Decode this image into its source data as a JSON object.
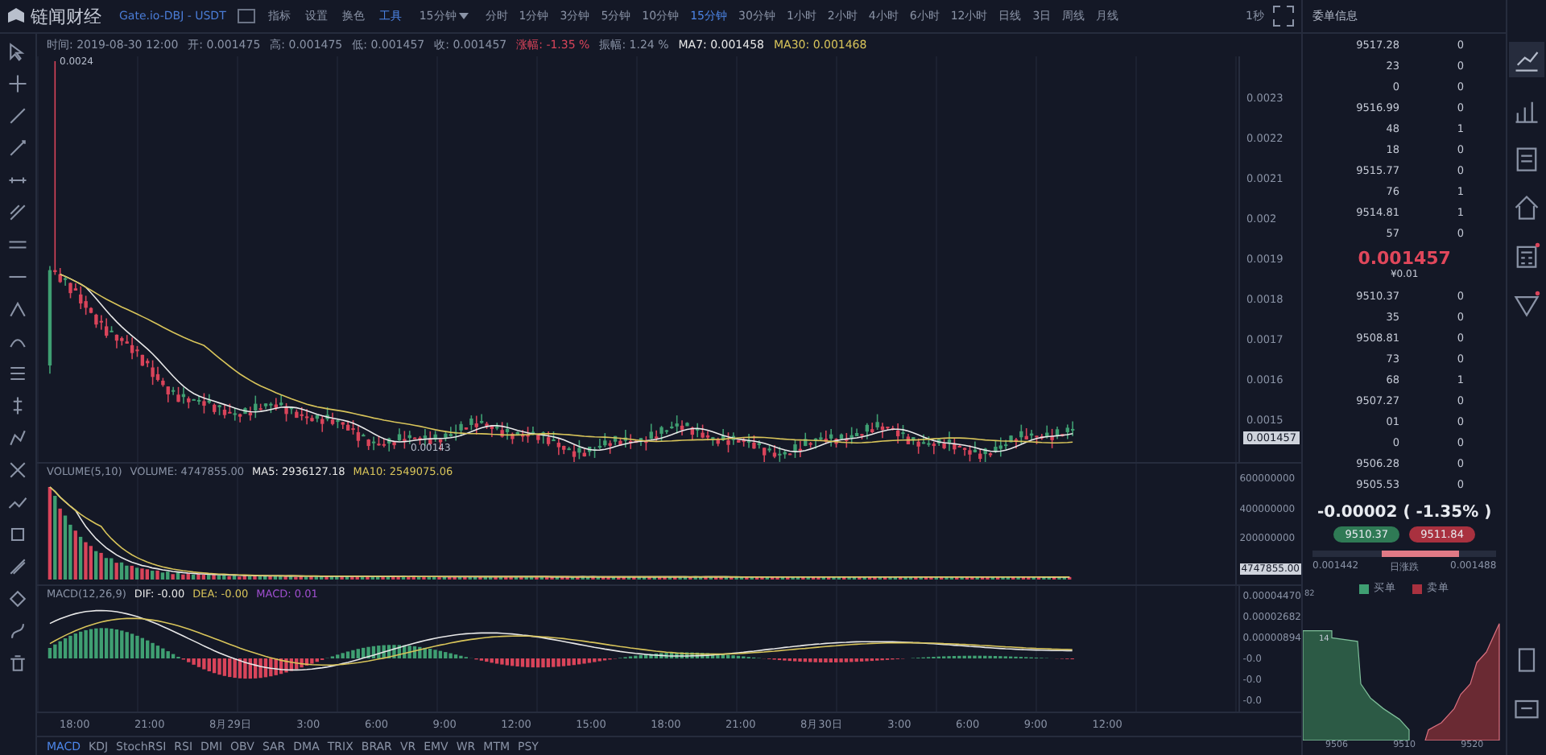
{
  "header": {
    "logo": "链闻财经",
    "pair": "Gate.io-DBJ - USDT",
    "tools": [
      {
        "label": "指标",
        "selected": false
      },
      {
        "label": "设置",
        "selected": false
      },
      {
        "label": "换色",
        "selected": false
      },
      {
        "label": "工具",
        "selected": true
      }
    ],
    "period_dropdown": "15分钟",
    "periods": [
      {
        "label": "分时",
        "selected": false
      },
      {
        "label": "1分钟",
        "selected": false
      },
      {
        "label": "3分钟",
        "selected": false
      },
      {
        "label": "5分钟",
        "selected": false
      },
      {
        "label": "10分钟",
        "selected": false
      },
      {
        "label": "15分钟",
        "selected": true
      },
      {
        "label": "30分钟",
        "selected": false
      },
      {
        "label": "1小时",
        "selected": false
      },
      {
        "label": "2小时",
        "selected": false
      },
      {
        "label": "4小时",
        "selected": false
      },
      {
        "label": "6小时",
        "selected": false
      },
      {
        "label": "12小时",
        "selected": false
      },
      {
        "label": "日线",
        "selected": false
      },
      {
        "label": "3日",
        "selected": false
      },
      {
        "label": "周线",
        "selected": false
      },
      {
        "label": "月线",
        "selected": false
      }
    ],
    "refresh": "1秒"
  },
  "info_line": [
    {
      "label": "时间:",
      "value": "2019-08-30 12:00",
      "kind": "normal"
    },
    {
      "label": "开:",
      "value": "0.001475",
      "kind": "normal"
    },
    {
      "label": "高:",
      "value": "0.001475",
      "kind": "normal"
    },
    {
      "label": "低:",
      "value": "0.001457",
      "kind": "normal"
    },
    {
      "label": "收:",
      "value": "0.001457",
      "kind": "normal"
    },
    {
      "label": "涨幅:",
      "value": "-1.35 %",
      "kind": "down"
    },
    {
      "label": "振幅:",
      "value": "1.24 %",
      "kind": "normal"
    },
    {
      "label": "MA7:",
      "value": "0.001458",
      "kind": "ma7"
    },
    {
      "label": "MA30:",
      "value": "0.001468",
      "kind": "ma30"
    }
  ],
  "price_chart": {
    "high_marker": "0.0024",
    "low_marker": "0.00143",
    "axis": [
      "0.0023",
      "0.0022",
      "0.0021",
      "0.002",
      "0.0019",
      "0.0018",
      "0.0017",
      "0.0016",
      "0.0015"
    ],
    "last_price": "0.001457"
  },
  "volume": {
    "legend": [
      {
        "label": "VOLUME(5,10)",
        "kind": "normal"
      },
      {
        "label": "VOLUME:",
        "value": "4747855.00",
        "kind": "normal"
      },
      {
        "label": "MA5:",
        "value": "2936127.18",
        "kind": "ma7"
      },
      {
        "label": "MA10:",
        "value": "2549075.06",
        "kind": "ma30"
      }
    ],
    "axis": [
      "600000000",
      "400000000",
      "200000000"
    ],
    "last": "4747855.00"
  },
  "macd": {
    "legend": [
      {
        "label": "MACD(12,26,9)",
        "kind": "normal"
      },
      {
        "label": "DIF:",
        "value": "-0.00",
        "kind": "ma7"
      },
      {
        "label": "DEA:",
        "value": "-0.00",
        "kind": "ma30"
      },
      {
        "label": "MACD:",
        "value": "0.01",
        "kind": "macd"
      }
    ],
    "axis": [
      "0.00004470",
      "0.00002682",
      "0.00000894",
      "-0.0",
      "-0.0",
      "-0.0"
    ]
  },
  "x_axis": [
    "18:00",
    "21:00",
    "8月29日",
    "3:00",
    "6:00",
    "9:00",
    "12:00",
    "15:00",
    "18:00",
    "21:00",
    "8月30日",
    "3:00",
    "6:00",
    "9:00",
    "12:00"
  ],
  "indicators": [
    {
      "label": "MACD",
      "selected": true
    },
    {
      "label": "KDJ",
      "selected": false
    },
    {
      "label": "StochRSI",
      "selected": false
    },
    {
      "label": "RSI",
      "selected": false
    },
    {
      "label": "DMI",
      "selected": false
    },
    {
      "label": "OBV",
      "selected": false
    },
    {
      "label": "SAR",
      "selected": false
    },
    {
      "label": "DMA",
      "selected": false
    },
    {
      "label": "TRIX",
      "selected": false
    },
    {
      "label": "BRAR",
      "selected": false
    },
    {
      "label": "VR",
      "selected": false
    },
    {
      "label": "EMV",
      "selected": false
    },
    {
      "label": "WR",
      "selected": false
    },
    {
      "label": "MTM",
      "selected": false
    },
    {
      "label": "PSY",
      "selected": false
    }
  ],
  "order_book": {
    "title": "委单信息",
    "asks": [
      {
        "price": "9517.28",
        "amount": "0"
      },
      {
        "price": "23",
        "amount": "0"
      },
      {
        "price": "0",
        "amount": "0"
      },
      {
        "price": "9516.99",
        "amount": "0"
      },
      {
        "price": "48",
        "amount": "1"
      },
      {
        "price": "18",
        "amount": "0"
      },
      {
        "price": "9515.77",
        "amount": "0"
      },
      {
        "price": "76",
        "amount": "1"
      },
      {
        "price": "9514.81",
        "amount": "1"
      },
      {
        "price": "57",
        "amount": "0"
      }
    ],
    "last_price": "0.001457",
    "last_sub": "¥0.01",
    "bids": [
      {
        "price": "9510.37",
        "amount": "0"
      },
      {
        "price": "35",
        "amount": "0"
      },
      {
        "price": "9508.81",
        "amount": "0"
      },
      {
        "price": "73",
        "amount": "0"
      },
      {
        "price": "68",
        "amount": "1"
      },
      {
        "price": "9507.27",
        "amount": "0"
      },
      {
        "price": "01",
        "amount": "0"
      },
      {
        "price": "0",
        "amount": "0"
      },
      {
        "price": "9506.28",
        "amount": "0"
      },
      {
        "price": "9505.53",
        "amount": "0"
      }
    ],
    "change": "-0.00002 ( -1.35% )",
    "bid_button": "9510.37",
    "ask_button": "9511.84",
    "range_low": "0.001442",
    "range_label": "日涨跌",
    "range_high": "0.001488",
    "legend": [
      "买单",
      "卖单"
    ],
    "depth_labels": [
      "82",
      "14"
    ],
    "depth_axis": [
      "9506",
      "9510",
      "9520"
    ]
  }
}
